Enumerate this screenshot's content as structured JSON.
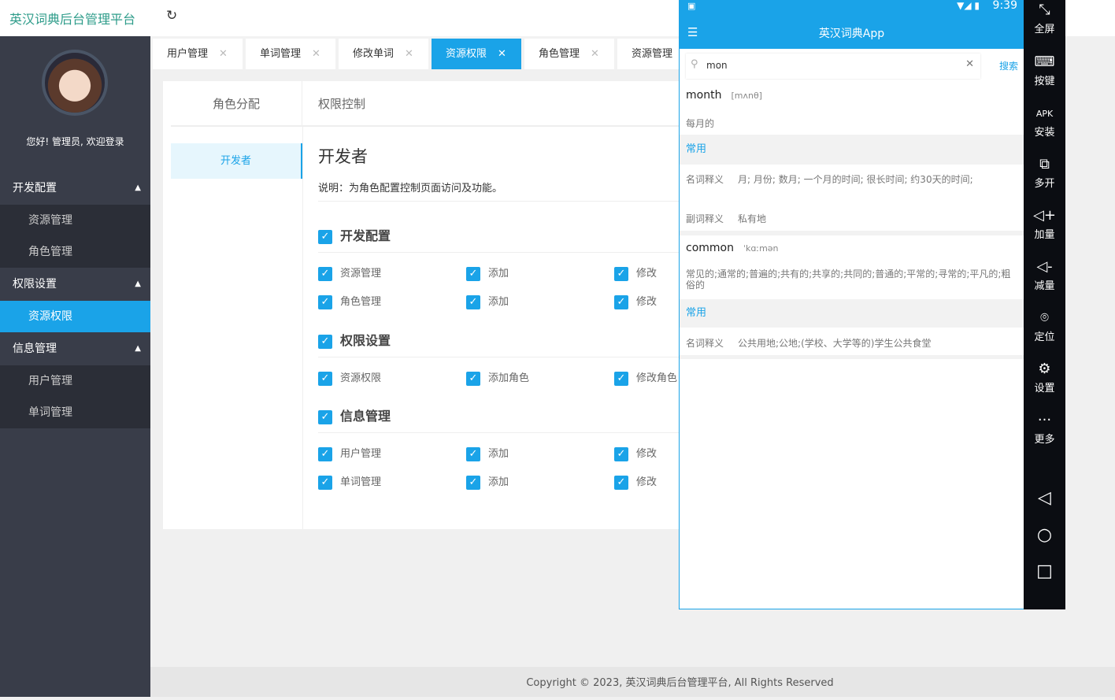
{
  "header": {
    "title": "英汉词典后台管理平台",
    "refresh_icon": "refresh-icon"
  },
  "sidebar": {
    "welcome": "您好! 管理员, 欢迎登录",
    "groups": [
      {
        "label": "开发配置",
        "items": [
          "资源管理",
          "角色管理"
        ]
      },
      {
        "label": "权限设置",
        "items": [
          "资源权限"
        ]
      },
      {
        "label": "信息管理",
        "items": [
          "用户管理",
          "单词管理"
        ]
      }
    ],
    "active_item": "资源权限"
  },
  "tabs": [
    {
      "label": "用户管理"
    },
    {
      "label": "单词管理"
    },
    {
      "label": "修改单词"
    },
    {
      "label": "资源权限",
      "active": true
    },
    {
      "label": "角色管理"
    },
    {
      "label": "资源管理"
    }
  ],
  "tab_close": "✕",
  "panel": {
    "tab_left": "角色分配",
    "tab_right": "权限控制",
    "role": "开发者",
    "role_title": "开发者",
    "description": "说明：为角色配置控制页面访问及功能。",
    "sections": [
      {
        "title": "开发配置",
        "rows": [
          [
            "资源管理",
            "添加",
            "修改"
          ],
          [
            "角色管理",
            "添加",
            "修改"
          ]
        ]
      },
      {
        "title": "权限设置",
        "rows": [
          [
            "资源权限",
            "添加角色",
            "修改角色"
          ]
        ]
      },
      {
        "title": "信息管理",
        "rows": [
          [
            "用户管理",
            "添加",
            "修改"
          ],
          [
            "单词管理",
            "添加",
            "修改"
          ]
        ]
      }
    ]
  },
  "footer": "Copyright © 2023, 英汉词典后台管理平台, All Rights Reserved",
  "phone": {
    "time": "9:39",
    "app_title": "英汉词典App",
    "search_value": "mon",
    "search_button": "搜索",
    "results": [
      {
        "word": "month",
        "phonetic": "[mʌnθ]",
        "summary": "每月的",
        "tag": "常用",
        "defs": [
          [
            "名词释义",
            "月; 月份; 数月; 一个月的时间; 很长时间; 约30天的时间;"
          ],
          [
            "副词释义",
            "私有地"
          ]
        ]
      },
      {
        "word": "common",
        "phonetic": "ˈkɑːmən",
        "summary": "常见的;通常的;普遍的;共有的;共享的;共同的;普通的;平常的;寻常的;平凡的;粗俗的",
        "tag": "常用",
        "defs": [
          [
            "名词释义",
            "公共用地;公地;(学校、大学等的)学生公共食堂"
          ]
        ]
      }
    ]
  },
  "emulator_toolbar": [
    "全屏",
    "按键",
    "安装",
    "多开",
    "加量",
    "减量",
    "定位",
    "设置",
    "更多"
  ],
  "colors": {
    "accent": "#1aa3e8",
    "sidebar": "#393d49",
    "logo": "#2e9c8a"
  }
}
